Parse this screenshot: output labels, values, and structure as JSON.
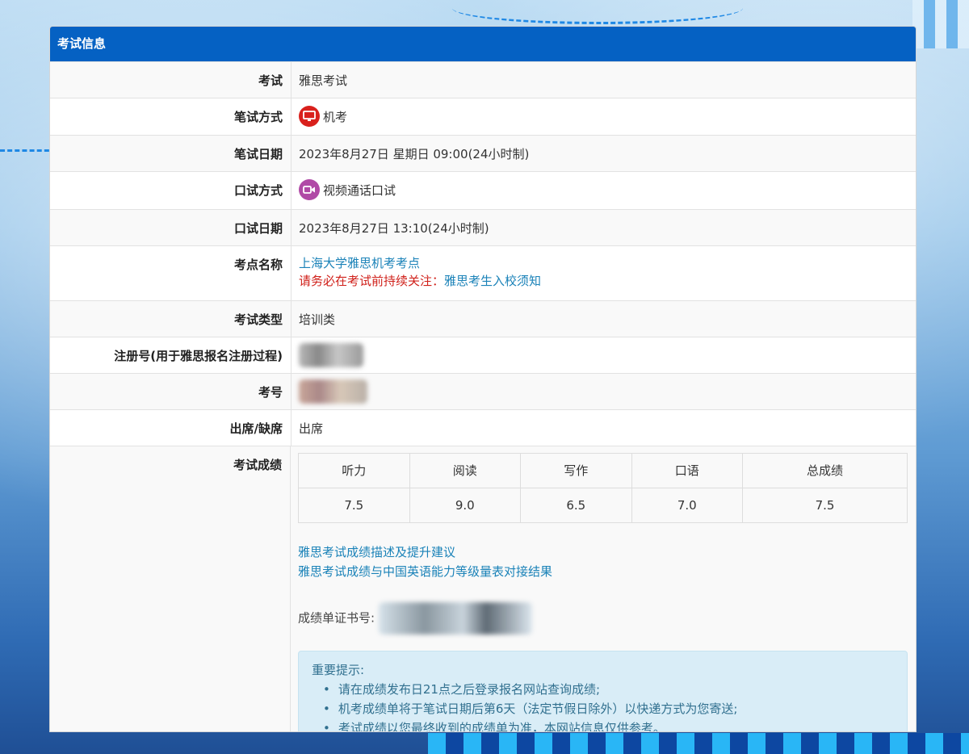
{
  "panel": {
    "title": "考试信息"
  },
  "rows": {
    "exam": {
      "label": "考试",
      "value": "雅思考试"
    },
    "written_mode": {
      "label": "笔试方式",
      "value": "机考",
      "icon": "computer-icon"
    },
    "written_date": {
      "label": "笔试日期",
      "value": "2023年8月27日 星期日 09:00(24小时制)"
    },
    "oral_mode": {
      "label": "口试方式",
      "value": "视频通话口试",
      "icon": "video-camera-icon"
    },
    "oral_date": {
      "label": "口试日期",
      "value": "2023年8月27日 13:10(24小时制)"
    },
    "center": {
      "label": "考点名称",
      "value": "上海大学雅思机考考点",
      "notice_prefix": "请务必在考试前持续关注：",
      "notice_link": "雅思考生入校须知"
    },
    "type": {
      "label": "考试类型",
      "value": "培训类"
    },
    "registration": {
      "label": "注册号(用于雅思报名注册过程)"
    },
    "candidate": {
      "label": "考号"
    },
    "attendance": {
      "label": "出席/缺席",
      "value": "出席"
    },
    "scores": {
      "label": "考试成绩"
    }
  },
  "scores": {
    "headers": [
      "听力",
      "阅读",
      "写作",
      "口语",
      "总成绩"
    ],
    "values": [
      "7.5",
      "9.0",
      "6.5",
      "7.0",
      "7.5"
    ]
  },
  "links": {
    "description": "雅思考试成绩描述及提升建议",
    "mapping": "雅思考试成绩与中国英语能力等级量表对接结果"
  },
  "certificate": {
    "label": "成绩单证书号:"
  },
  "notice": {
    "title": "重要提示:",
    "items": [
      "请在成绩发布日21点之后登录报名网站查询成绩;",
      "机考成绩单将于笔试日期后第6天（法定节假日除外）以快递方式为您寄送;",
      "考试成绩以您最终收到的成绩单为准，本网站信息仅供参考。"
    ]
  },
  "colors": {
    "header": "#0561c3",
    "link": "#1a82b8",
    "warning": "#d0201a",
    "alert_bg": "#d9edf7"
  }
}
